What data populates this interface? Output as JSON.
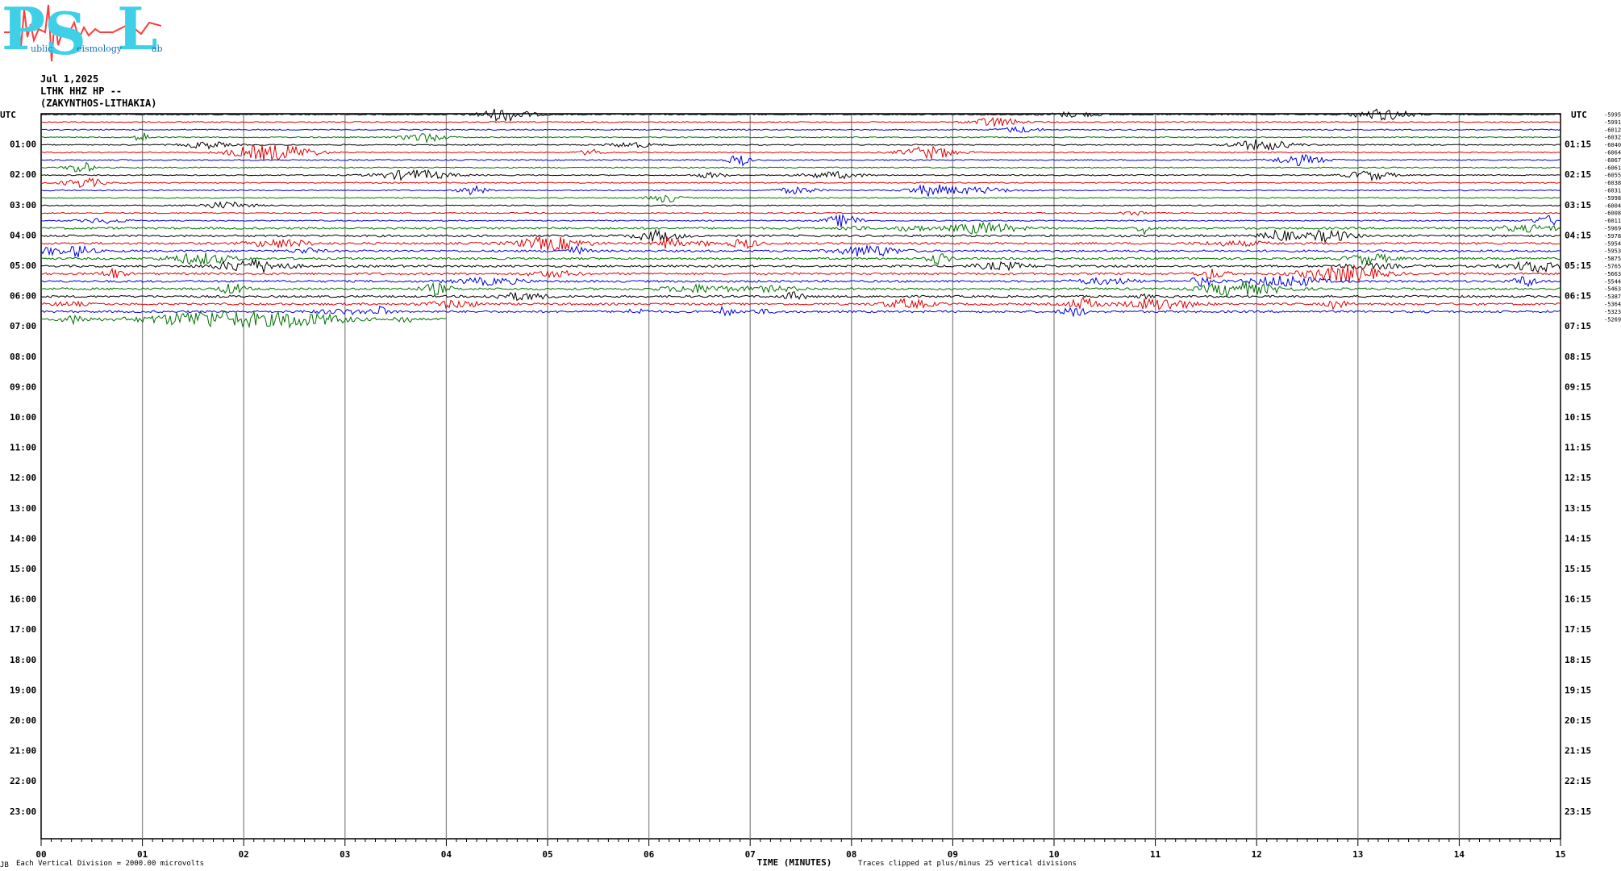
{
  "logo": {
    "letters": [
      "P",
      "S",
      "L"
    ],
    "words": [
      "ublic",
      "eismology",
      "ab"
    ],
    "line_color": "#ff3b3b",
    "letter_color": "#3fd0e8"
  },
  "header": {
    "date": "Jul 1,2025",
    "station": "LTHK HHZ HP --",
    "location": "(ZAKYNTHOS-LITHAKIA)"
  },
  "chart_data": {
    "type": "line",
    "title": "",
    "xlabel": "TIME (MINUTES)",
    "ylabel": "UTC",
    "xlim": [
      0,
      15
    ],
    "x_ticks": [
      "00",
      "01",
      "02",
      "03",
      "04",
      "05",
      "06",
      "07",
      "08",
      "09",
      "10",
      "11",
      "12",
      "13",
      "14",
      "15"
    ],
    "left_hour_labels": [
      "01:00",
      "02:00",
      "03:00",
      "04:00",
      "05:00",
      "06:00",
      "07:00",
      "08:00",
      "09:00",
      "10:00",
      "11:00",
      "12:00",
      "13:00",
      "14:00",
      "15:00",
      "16:00",
      "17:00",
      "18:00",
      "19:00",
      "20:00",
      "21:00",
      "22:00",
      "23:00"
    ],
    "right_hour_labels": [
      "01:15",
      "02:15",
      "03:15",
      "04:15",
      "05:15",
      "06:15",
      "07:15",
      "08:15",
      "09:15",
      "10:15",
      "11:15",
      "12:15",
      "13:15",
      "14:15",
      "15:15",
      "16:15",
      "17:15",
      "18:15",
      "19:15",
      "20:15",
      "21:15",
      "22:15",
      "23:15"
    ],
    "trace_colors": [
      "#000000",
      "#e00000",
      "#0000e0",
      "#007000"
    ],
    "trace_offsets": [
      "-5995",
      "-5991",
      "-6012",
      "-6032",
      "-6040",
      "-6064",
      "-6067",
      "-6061",
      "-6055",
      "-6038",
      "-6031",
      "-5998",
      "-6004",
      "-6008",
      "-6011",
      "-5969",
      "-5978",
      "-5954",
      "-5953",
      "-5875",
      "-5765",
      "-5663",
      "-5544",
      "-5463",
      "-5387",
      "-5364",
      "-5323",
      "-5269"
    ],
    "last_trace_end_minute": 4.0,
    "grid": true,
    "scale_note": "Each Vertical Division = 2000.00 microvolts",
    "clip_note": "Traces clipped at plus/minus 25 vertical divisions"
  },
  "footer": {
    "corner_mark": "JB"
  }
}
